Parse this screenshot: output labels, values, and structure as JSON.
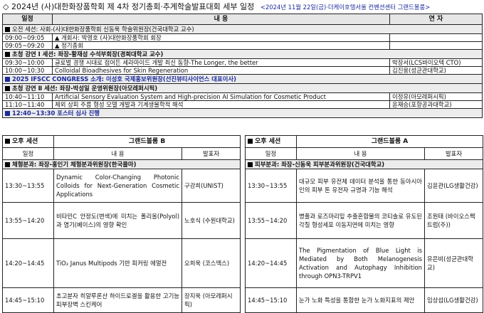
{
  "title": {
    "main": "◇ 2024년 (사)대한화장품학회 제 4차 정기총회·추계학술발표대회 세부 일정",
    "sub": "<2024년 11월 22일(금)·더케이호텔서울 컨벤션센터 그랜드볼룸>"
  },
  "top": {
    "headers": [
      "일정",
      "내 용",
      "연 자"
    ],
    "rows": [
      {
        "type": "sec",
        "marker": "sq",
        "text": "오전 세션: 사회-(사)대한화장품학회 신동욱 학술위원장(건국대학교 교수)",
        "bold": false
      },
      {
        "type": "row",
        "time": "09:00~09:05",
        "content": "▲ 개회사: 박영호 (사)대한화장품학회 회장",
        "speaker": ""
      },
      {
        "type": "row",
        "time": "09:05~09:20",
        "content": "▲ 정기총회",
        "speaker": ""
      },
      {
        "type": "sec",
        "marker": "sq",
        "text": "초청 강연 Ⅰ 세션: 좌장-황재성 수석부회장(경희대학교 교수)",
        "bold": true
      },
      {
        "type": "row",
        "time": "09:30~10:00",
        "content": "글로벌 경쟁 시대로 접어든 세라마이드 개발 최신 동향-The Longer, the better",
        "speaker": "박장서(LCS바이오텍 CTO)"
      },
      {
        "type": "row",
        "time": "10:00~10:30",
        "content": "Colloidal Bioadhesives for Skin Regeneration",
        "speaker": "김진웅(성균관대학교)"
      },
      {
        "type": "blue",
        "marker": "bsq",
        "text": "2025 IFSCC CONGRESS 소개: 이성호 국제홍보위원장(선진뷰티사이언스 대표이사)"
      },
      {
        "type": "sec",
        "marker": "sq",
        "text": "초청 강연 Ⅱ 세션: 좌장-박성일 운영위원장(아모레퍼시픽)",
        "bold": true
      },
      {
        "type": "row",
        "time": "10:40~11:10",
        "content": "Artificial Sensory Evaluation System and High-precision AI Simulation for Cosmetic Product",
        "speaker": "이정유(아모레퍼시픽)"
      },
      {
        "type": "row",
        "time": "11:10~11:40",
        "content": "체외 상피 주름 형성 모델 개발과 기계생물학적 해석",
        "speaker": "윤재승(포항공과대학교)"
      },
      {
        "type": "blue",
        "marker": "bsq",
        "text": "12:40~13:30 포스터 심사 진행"
      }
    ]
  },
  "sessionB": {
    "session_label": "오후 세션",
    "room": "그랜드볼룸 B",
    "headers": [
      "일정",
      "내 용",
      "발표자"
    ],
    "sec": "체형분과: 좌장-홍인기 체형분과위원장(한국콜마)",
    "rows": [
      {
        "time": "13:30~13:55",
        "content": "Dynamic Color-Changing Photonic Colloids for Next-Generation Cosmetic Applications",
        "speaker": "구강희(UNIST)"
      },
      {
        "time": "13:55~14:20",
        "content": "비타민C 안정도(변색)에 미치는 폴리올(Polyol)과 염기(베이스)의 영향 확인",
        "speaker": "노호식 (수원대학교)"
      },
      {
        "time": "14:20~14:45",
        "content": "TiO₂ Janus Multipods 기반 피커링 에멀전",
        "speaker": "오희욱 (코스맥스)"
      },
      {
        "time": "14:45~15:10",
        "content": "초고분자 히알루론산 하이드로겔을 활용한 고기능 피부장벽 스킨케어",
        "speaker": "장지욱 (아모레퍼시픽)"
      }
    ]
  },
  "sessionA": {
    "session_label": "오후 세션",
    "room": "그랜드볼룸 A",
    "headers": [
      "일정",
      "내 용",
      "발표자"
    ],
    "sec": "피부분과: 좌장-신동욱 피부분과위원장(건국대학교)",
    "rows": [
      {
        "time": "13:30~13:55",
        "content": "대규모 피부 유전체 데이터 분석을 통한 동아시아인의 피부 톤 유전자 규명과 기능 해석",
        "speaker": "김윤관(LG생활건강)"
      },
      {
        "time": "13:55~14:20",
        "content": "병풀과 로즈마리잎 추출혼합물의 코티솔로 유도된 각질 형성세포 이동지연에 미치는 영향",
        "speaker": "조원태 (바이오스펙트럼(주))"
      },
      {
        "time": "14:20~14:45",
        "content": "The Pigmentation of Blue Light is Mediated by Both Melanogenesis Activation and Autophagy Inhibition through OPN3-TRPV1",
        "speaker": "유은비(성균관대학교)"
      },
      {
        "time": "14:45~15:10",
        "content": "눈가 노화 특성을 통합한 눈가 노화지표의 제안",
        "speaker": "임상섭(LG생활건강)"
      }
    ]
  }
}
